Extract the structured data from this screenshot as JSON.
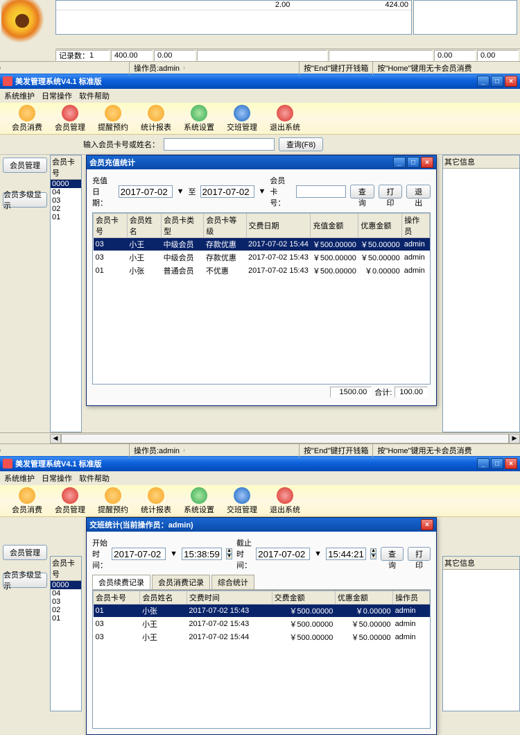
{
  "top_fragment": {
    "row_values": [
      "2.00",
      "424.00"
    ],
    "record_count_label": "记录数：",
    "record_count_value": "1",
    "cells": [
      "400.00",
      "0.00",
      "",
      "0.00",
      "0.00"
    ],
    "status_operator_label": "操作员:admin",
    "status_end": "按\"End\"键打开钱箱",
    "status_home": "按\"Home\"键用无卡会员消费"
  },
  "app": {
    "title": "美发管理系统V4.1 标准版",
    "menus": [
      "系统维护",
      "日常操作",
      "软件帮助"
    ],
    "toolbar": [
      {
        "label": "会员消费",
        "cls": "orange"
      },
      {
        "label": "会员管理",
        "cls": "red"
      },
      {
        "label": "提醒预约",
        "cls": "orange"
      },
      {
        "label": "统计报表",
        "cls": "orange"
      },
      {
        "label": "系统设置",
        "cls": "green"
      },
      {
        "label": "交班管理",
        "cls": "blue"
      },
      {
        "label": "退出系统",
        "cls": "red"
      }
    ],
    "search_label": "输入会员卡号或姓名：",
    "query_btn": "查询(F8)",
    "side_btns": [
      "会员管理",
      "会员多级显示"
    ],
    "left_header": "会员卡号",
    "left_sel": "0000",
    "left_rows": [
      "04",
      "03",
      "02",
      "01"
    ],
    "right_header": "其它信息",
    "status_operator_label": "操作员:admin",
    "status_end": "按\"End\"键打开钱箱",
    "status_home": "按\"Home\"键用无卡会员消费"
  },
  "recharge_dialog": {
    "title": "会员充值统计",
    "date_label": "充值日期：",
    "date_to": "至",
    "date1": "2017-07-02",
    "date2": "2017-07-02",
    "card_label": "会员卡号：",
    "btn_query": "查询",
    "btn_print": "打印",
    "btn_exit": "退出",
    "columns": [
      "会员卡号",
      "会员姓名",
      "会员卡类型",
      "会员卡等级",
      "交费日期",
      "充值金额",
      "优惠金额",
      "操作员"
    ],
    "rows": [
      {
        "card": "03",
        "name": "小王",
        "type": "中级会员",
        "grade": "存款优惠",
        "date": "2017-07-02 15:44",
        "amount": "￥500.00000",
        "bonus": "￥50.00000",
        "op": "admin",
        "sel": true
      },
      {
        "card": "03",
        "name": "小王",
        "type": "中级会员",
        "grade": "存款优惠",
        "date": "2017-07-02 15:43",
        "amount": "￥500.00000",
        "bonus": "￥50.00000",
        "op": "admin"
      },
      {
        "card": "01",
        "name": "小张",
        "type": "普通会员",
        "grade": "不优惠",
        "date": "2017-07-02 15:43",
        "amount": "￥500.00000",
        "bonus": "￥0.00000",
        "op": "admin"
      }
    ],
    "sum1": "1500.00",
    "sum_label": "合计:",
    "sum2": "100.00"
  },
  "shift_dialog": {
    "title": "交班统计(当前操作员：admin)",
    "start_label": "开始时间：",
    "end_label": "截止时间：",
    "date1": "2017-07-02",
    "time1": "15:38:59",
    "date2": "2017-07-02",
    "time2": "15:44:21",
    "btn_query": "查询",
    "btn_print": "打印",
    "tabs": [
      "会员续费记录",
      "会员消费记录",
      "综合统计"
    ],
    "columns": [
      "会员卡号",
      "会员姓名",
      "交费时间",
      "交费金额",
      "优惠金额",
      "操作员"
    ],
    "rows": [
      {
        "card": "01",
        "name": "小张",
        "date": "2017-07-02 15:43",
        "amount": "￥500.00000",
        "bonus": "￥0.00000",
        "op": "admin",
        "sel": true
      },
      {
        "card": "03",
        "name": "小王",
        "date": "2017-07-02 15:43",
        "amount": "￥500.00000",
        "bonus": "￥50.00000",
        "op": "admin"
      },
      {
        "card": "03",
        "name": "小王",
        "date": "2017-07-02 15:44",
        "amount": "￥500.00000",
        "bonus": "￥50.00000",
        "op": "admin"
      }
    ]
  }
}
